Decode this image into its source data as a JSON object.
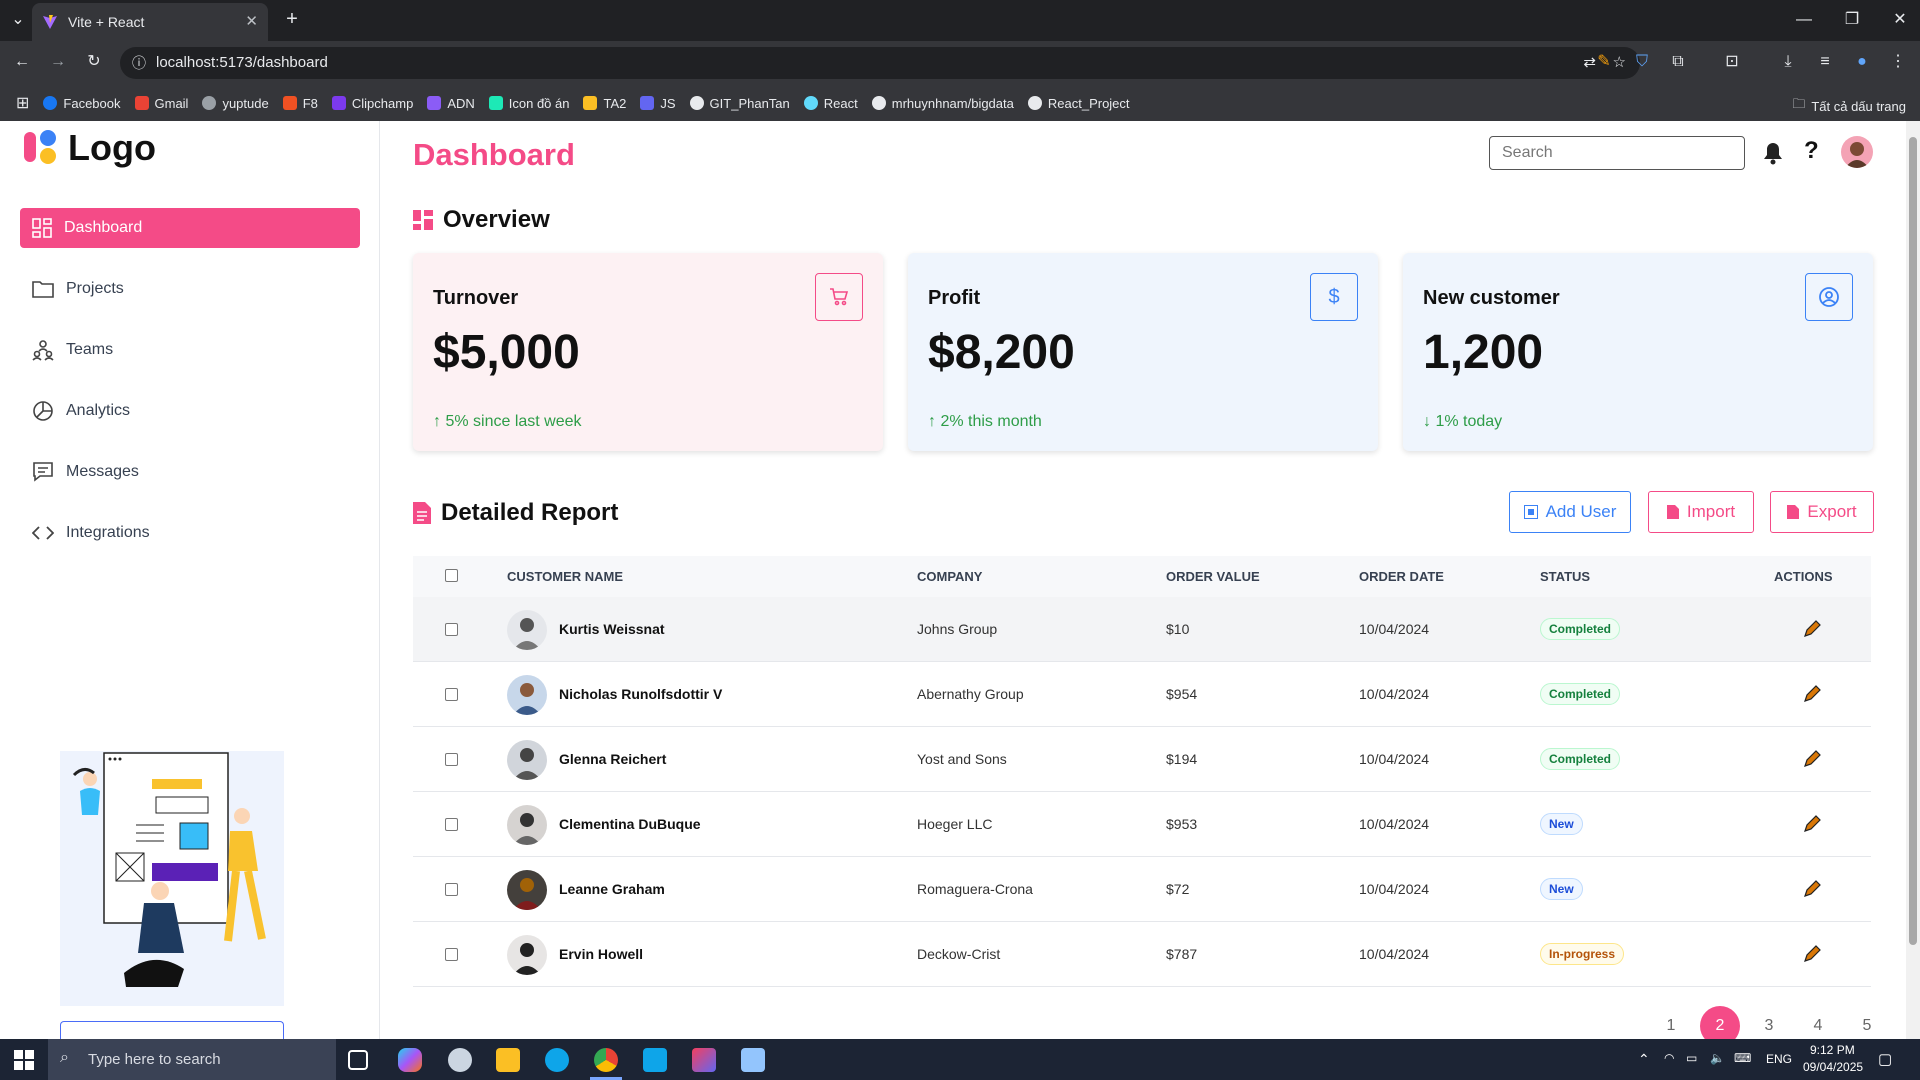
{
  "browser": {
    "tab_title": "Vite + React",
    "url": "localhost:5173/dashboard",
    "bookmarks": [
      "Facebook",
      "Gmail",
      "yuptude",
      "F8",
      "Clipchamp",
      "ADN",
      "Icon đồ án",
      "TA2",
      "JS",
      "GIT_PhanTan",
      "React",
      "mrhuynhnam/bigdata",
      "React_Project"
    ],
    "all_bookmarks": "Tất cả dấu trang"
  },
  "sidebar": {
    "logo_text": "Logo",
    "items": [
      {
        "label": "Dashboard",
        "icon": "dashboard-icon",
        "active": true
      },
      {
        "label": "Projects",
        "icon": "folder-icon"
      },
      {
        "label": "Teams",
        "icon": "teams-icon"
      },
      {
        "label": "Analytics",
        "icon": "pie-chart-icon"
      },
      {
        "label": "Messages",
        "icon": "message-icon"
      },
      {
        "label": "Integrations",
        "icon": "code-icon"
      }
    ]
  },
  "header": {
    "title": "Dashboard",
    "search_placeholder": "Search"
  },
  "overview": {
    "title": "Overview",
    "cards": [
      {
        "label": "Turnover",
        "value": "$5,000",
        "delta": "↑ 5% since last week",
        "icon": "cart-icon",
        "accent": "#f44b87",
        "bg": "#fdf1f3"
      },
      {
        "label": "Profit",
        "value": "$8,200",
        "delta": "↑ 2% this month",
        "icon": "dollar-icon",
        "accent": "#3b82f6",
        "bg": "#eff5fd"
      },
      {
        "label": "New customer",
        "value": "1,200",
        "delta": "↓ 1% today",
        "icon": "user-circle-icon",
        "accent": "#3b82f6",
        "bg": "#eff5fd"
      }
    ]
  },
  "report": {
    "title": "Detailed Report",
    "buttons": {
      "add_user": "Add User",
      "import": "Import",
      "export": "Export"
    },
    "columns": [
      "CUSTOMER NAME",
      "COMPANY",
      "ORDER VALUE",
      "ORDER DATE",
      "STATUS",
      "ACTIONS"
    ],
    "rows": [
      {
        "name": "Kurtis Weissnat",
        "company": "Johns Group",
        "value": "$10",
        "date": "10/04/2024",
        "status": "Completed"
      },
      {
        "name": "Nicholas Runolfsdottir V",
        "company": "Abernathy Group",
        "value": "$954",
        "date": "10/04/2024",
        "status": "Completed"
      },
      {
        "name": "Glenna Reichert",
        "company": "Yost and Sons",
        "value": "$194",
        "date": "10/04/2024",
        "status": "Completed"
      },
      {
        "name": "Clementina DuBuque",
        "company": "Hoeger LLC",
        "value": "$953",
        "date": "10/04/2024",
        "status": "New"
      },
      {
        "name": "Leanne Graham",
        "company": "Romaguera-Crona",
        "value": "$72",
        "date": "10/04/2024",
        "status": "New"
      },
      {
        "name": "Ervin Howell",
        "company": "Deckow-Crist",
        "value": "$787",
        "date": "10/04/2024",
        "status": "In-progress"
      }
    ],
    "pages": [
      "1",
      "2",
      "3",
      "4",
      "5"
    ],
    "current_page": "2"
  },
  "status_colors": {
    "Completed": {
      "fg": "#15803d",
      "bg": "#f0fdf4",
      "border": "#bbf7d0"
    },
    "New": {
      "fg": "#1d4ed8",
      "bg": "#eff6ff",
      "border": "#bfdbfe"
    },
    "In-progress": {
      "fg": "#b45309",
      "bg": "#fffbeb",
      "border": "#fde68a"
    }
  },
  "taskbar": {
    "search_placeholder": "Type here to search",
    "lang": "ENG",
    "time": "9:12 PM",
    "date": "09/04/2025"
  }
}
